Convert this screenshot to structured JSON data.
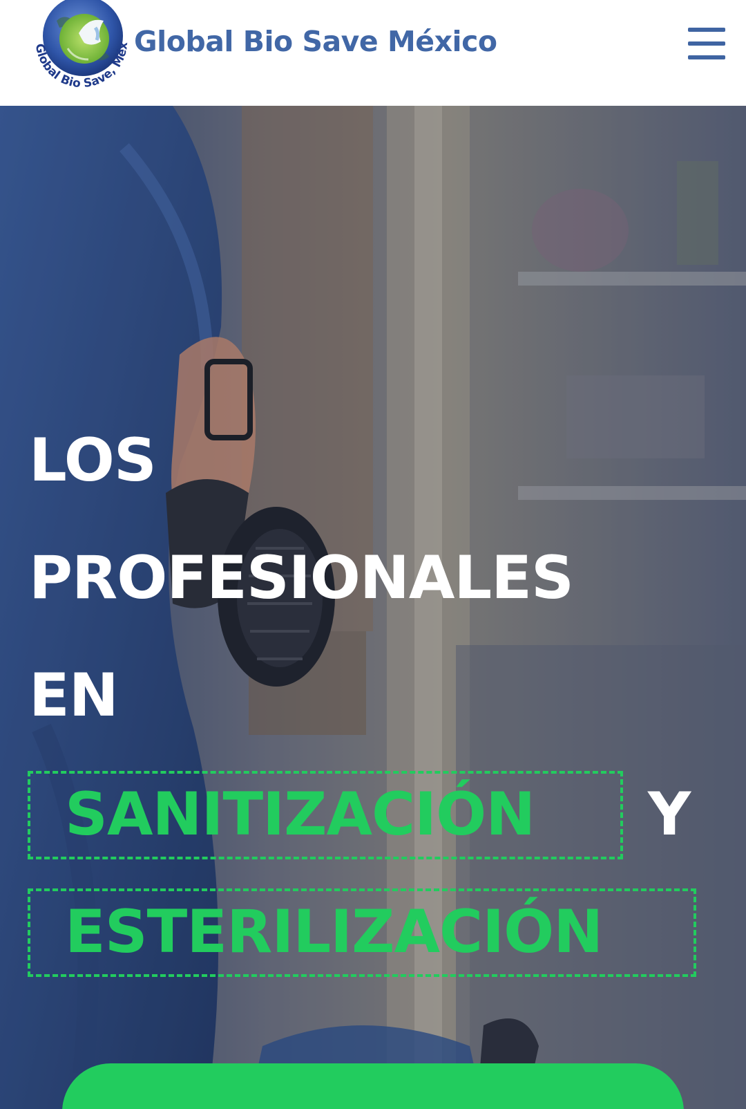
{
  "header": {
    "brand_name": "Global Bio Save México",
    "logo_text": "Global Bio Save, México",
    "menu_icon": "hamburger-menu-icon"
  },
  "hero": {
    "headline_line_1": "LOS",
    "headline_line_2": "PROFESIONALES",
    "headline_line_3": "EN",
    "highlight_1": "SANITIZACIÓN",
    "connector": "Y",
    "highlight_2": "ESTERILIZACIÓN",
    "cta_label": ""
  },
  "colors": {
    "brand_blue": "#4167a6",
    "accent_green": "#22cc5e",
    "headline_white": "#ffffff"
  }
}
